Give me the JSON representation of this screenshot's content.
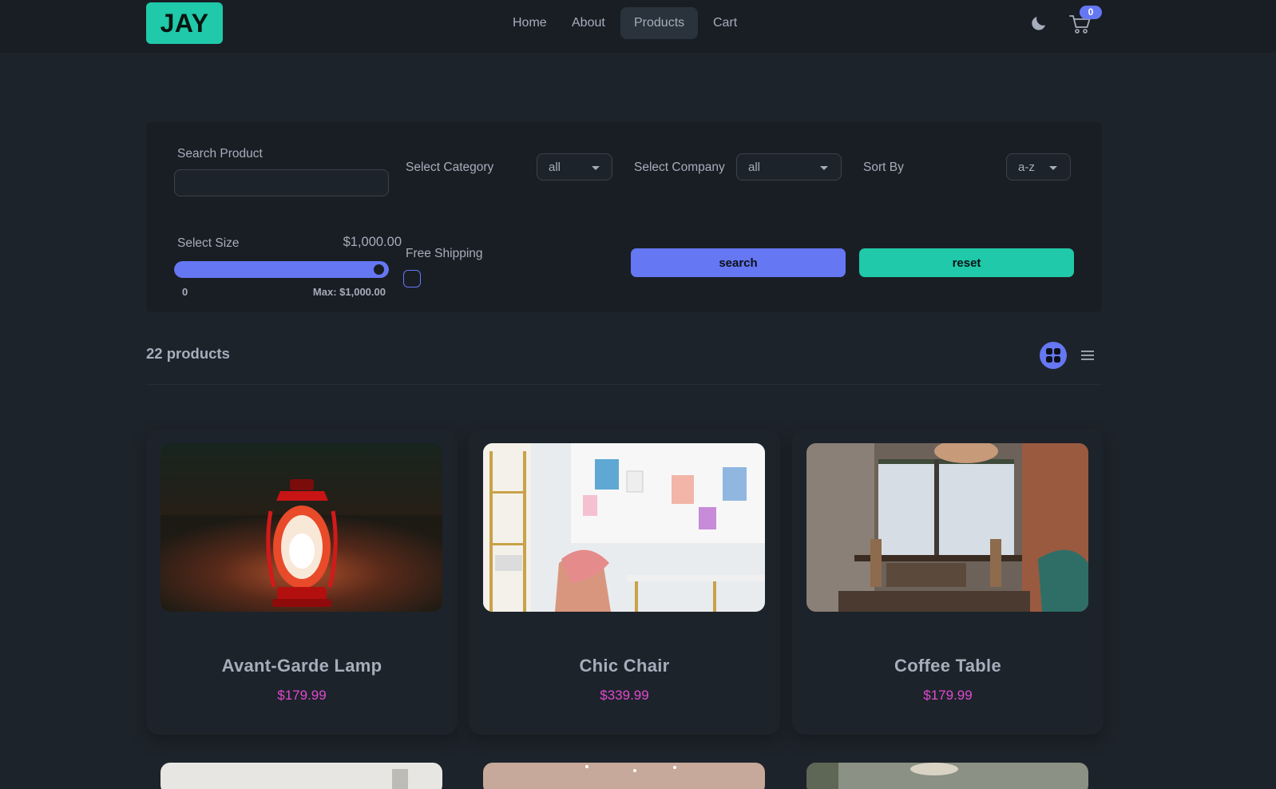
{
  "nav": {
    "logo": "JAY",
    "links": [
      "Home",
      "About",
      "Products",
      "Cart"
    ],
    "active_link": "Products",
    "cart_count": "0",
    "icons": {
      "theme": "moon-icon",
      "cart": "cart-icon"
    }
  },
  "filters": {
    "search_label": "Search Product",
    "search_value": "",
    "category_label": "Select Category",
    "category_value": "all",
    "company_label": "Select Company",
    "company_value": "all",
    "sort_label": "Sort By",
    "sort_value": "a-z",
    "size_label": "Select Size",
    "size_value": "$1,000.00",
    "size_level": 1.0,
    "size_min": "0",
    "size_max": "Max: $1,000.00",
    "shipping_label": "Free Shipping",
    "shipping_checked": false,
    "search_button": "search",
    "reset_button": "reset"
  },
  "products": {
    "count_label": "22 products",
    "icons": {
      "grid": "grid-view-icon",
      "list": "list-view-icon"
    },
    "items": [
      {
        "title": "Avant-Garde Lamp",
        "price": "$179.99"
      },
      {
        "title": "Chic Chair",
        "price": "$339.99"
      },
      {
        "title": "Coffee Table",
        "price": "$179.99"
      }
    ]
  },
  "colors": {
    "primary": "#6577f3",
    "secondary": "#1fc9a9",
    "price": "#e04ad0",
    "background": "#1d232a"
  }
}
